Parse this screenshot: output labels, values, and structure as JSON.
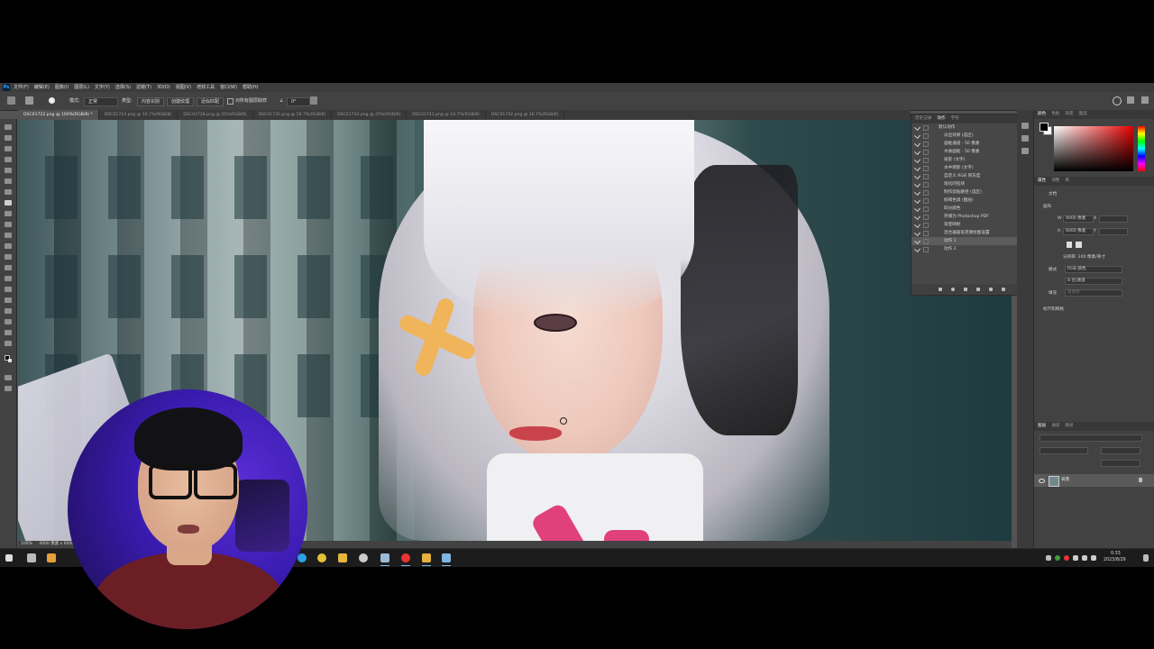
{
  "menubar": {
    "app_icon": "Ps",
    "menus": [
      "文件(F)",
      "编辑(E)",
      "图像(I)",
      "图层(L)",
      "文字(Y)",
      "选择(S)",
      "滤镜(T)",
      "3D(D)",
      "视图(V)",
      "增效工具",
      "窗口(W)",
      "帮助(H)"
    ]
  },
  "options": {
    "mode_label": "模式:",
    "mode_value": "正常",
    "type_label": "类型:",
    "btn_content_aware": "内容识别",
    "btn_create_texture": "创建纹理",
    "btn_proximity": "近似匹配",
    "sample_all_layers": "对所有图层取样",
    "angle_value": "0°"
  },
  "tabs": [
    {
      "label": "DSC01722.png @ 100%(RGB/8) *",
      "active": true
    },
    {
      "label": "DSC01724.png @ 16.7%(RGB/8)",
      "active": false
    },
    {
      "label": "DSC01728.png @ 25%(RGB/8)",
      "active": false
    },
    {
      "label": "DSC01732.png @ 16.7%(RGB/8)",
      "active": false
    },
    {
      "label": "DSC01734.png @ 25%(RGB/8)",
      "active": false
    },
    {
      "label": "DSC01741.png @ 16.7%(RGB/8)",
      "active": false
    },
    {
      "label": "DSC01742.png @ 16.7%(RGB/8)",
      "active": false
    }
  ],
  "statusbar": {
    "zoom": "100%",
    "info": "4000 像素 x 6000 像素 (240 ppi)"
  },
  "actions_panel": {
    "tabs": [
      "历史记录",
      "动作",
      "字符"
    ],
    "active_tab": "动作",
    "items": [
      {
        "label": "默认动作",
        "selected": false
      },
      {
        "label": "淡出效果 (选区)",
        "selected": false
      },
      {
        "label": "画框通道 - 50 像素",
        "selected": false
      },
      {
        "label": "木质画框 - 50 像素",
        "selected": false
      },
      {
        "label": "投影 (文字)",
        "selected": false
      },
      {
        "label": "水中倒影 (文字)",
        "selected": false
      },
      {
        "label": "自定义 RGB 到灰度",
        "selected": false
      },
      {
        "label": "熔化的铅块",
        "selected": false
      },
      {
        "label": "制作剪贴路径 (选区)",
        "selected": false
      },
      {
        "label": "棕褐色调 (图层)",
        "selected": false
      },
      {
        "label": "四分颜色",
        "selected": false
      },
      {
        "label": "存储为 Photoshop PDF",
        "selected": false
      },
      {
        "label": "渐变映射",
        "selected": false
      },
      {
        "label": "混合器画笔克隆绘图设置",
        "selected": false
      },
      {
        "label": "动作 1",
        "selected": true
      },
      {
        "label": "动作 2",
        "selected": false
      }
    ]
  },
  "color_panel": {
    "tabs": [
      "颜色",
      "色板",
      "渐变",
      "图案"
    ],
    "fg_color": "#000000",
    "bg_color": "#ffffff"
  },
  "properties_panel": {
    "tabs": [
      "属性",
      "调整",
      "库"
    ],
    "doc_label": "文档",
    "section_canvas": "画布",
    "w_label": "W",
    "w_value": "4000 像素",
    "h_label": "H",
    "h_value": "6000 像素",
    "x_label": "X",
    "y_label": "Y",
    "resolution": "分辨率: 240 像素/英寸",
    "mode_label": "模式",
    "mode_value": "RGB 颜色",
    "depth_value": "8 位/通道",
    "fill_label": "填充",
    "fill_value": "背景色",
    "section_rulers": "标尺和网格"
  },
  "layers_panel": {
    "tabs": [
      "图层",
      "通道",
      "路径"
    ],
    "layer_name": "背景"
  },
  "taskbar": {
    "time": "0:33",
    "date": "2023/8/29"
  }
}
